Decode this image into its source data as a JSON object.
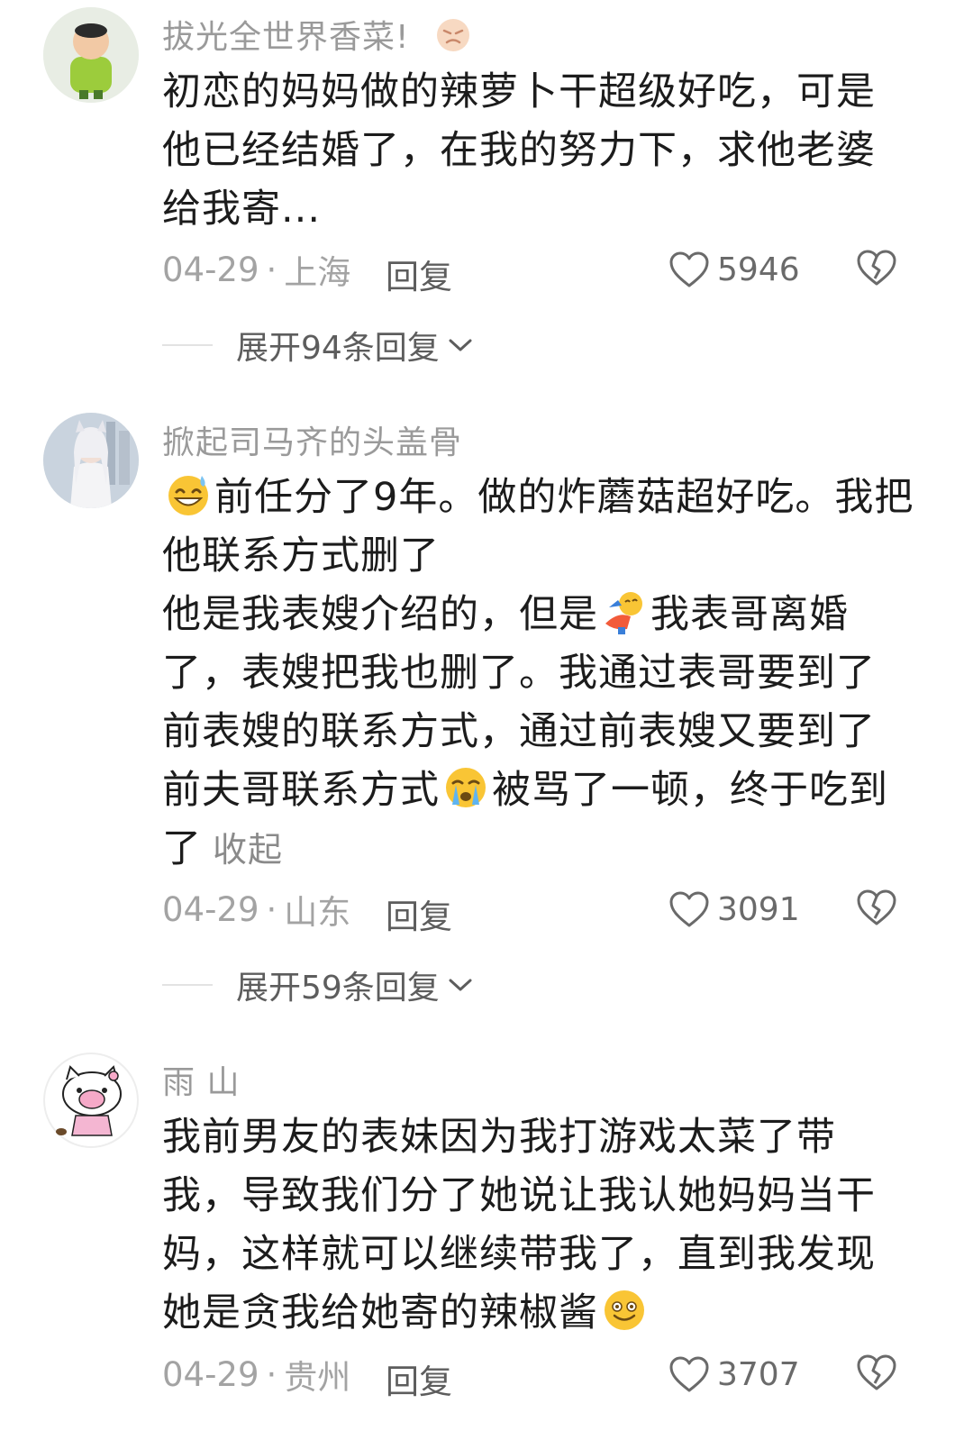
{
  "comments": [
    {
      "username": "拔光全世界香菜!",
      "text_lines": [
        "初恋的妈妈做的辣萝卜干超级好吃，可是",
        "他已经结婚了，在我的努力下，求他老婆",
        "给我寄..."
      ],
      "date": "04-29",
      "location": "上海",
      "reply_label": "回复",
      "likes": "5946",
      "expand_label": "展开94条回复"
    },
    {
      "username": "掀起司马齐的头盖骨",
      "line1": "前任分了9年。做的炸蘑菇超好吃。我把",
      "line2": "他联系方式删了",
      "line3a": "他是我表嫂介绍的，但是",
      "line3b": "我表哥离婚",
      "line4": "了，表嫂把我也删了。我通过表哥要到了",
      "line5": "前表嫂的联系方式，通过前表嫂又要到了",
      "line6a": "前夫哥联系方式",
      "line6b": "被骂了一顿，终于吃到",
      "line7": "了",
      "collapse_label": "收起",
      "date": "04-29",
      "location": "山东",
      "reply_label": "回复",
      "likes": "3091",
      "expand_label": "展开59条回复"
    },
    {
      "username": "雨 山",
      "text_lines": [
        "我前男友的表妹因为我打游戏太菜了带",
        "我，导致我们分了她说让我认她妈妈当干",
        "妈，这样就可以继续带我了，直到我发现"
      ],
      "last_line": "她是贪我给她寄的辣椒酱",
      "date": "04-29",
      "location": "贵州",
      "reply_label": "回复",
      "likes": "3707"
    }
  ],
  "separator": "·",
  "colors": {
    "meta": "#a3a3a3",
    "username": "#9a9a9a",
    "text": "#1c1c1c"
  },
  "icons": [
    "heart-icon",
    "broken-heart-icon",
    "chevron-down-icon",
    "angry-emoji",
    "grin-sweat-emoji",
    "bowing-emoji",
    "crying-emoji",
    "smile-emoji"
  ]
}
